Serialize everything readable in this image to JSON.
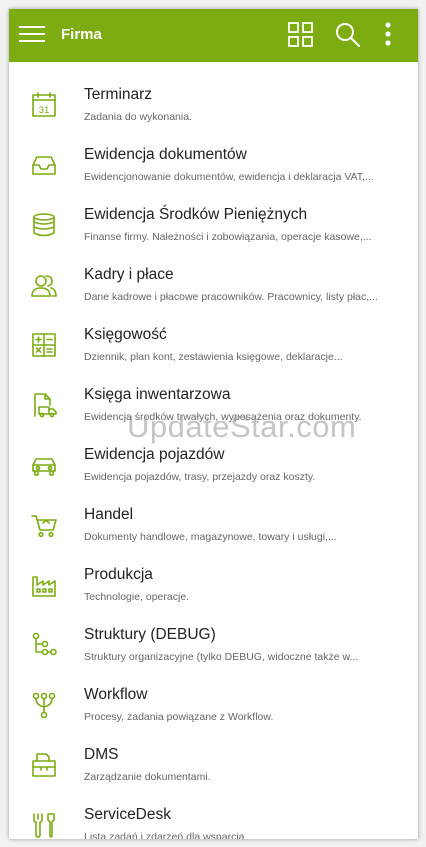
{
  "app": {
    "title": "Firma"
  },
  "toolbar": {
    "menu_icon": "hamburger-menu-icon",
    "grid_icon": "grid-view-icon",
    "search_icon": "search-icon",
    "more_icon": "more-vertical-icon"
  },
  "colors": {
    "accent": "#7cab12",
    "background": "#ffffff"
  },
  "modules": [
    {
      "name": "Terminarz",
      "desc": "Zadania do wykonania.",
      "icon": "calendar-icon"
    },
    {
      "name": "Ewidencja dokumentów",
      "desc": "Ewidencjonowanie dokumentów, ewidencja i deklaracja VAT,...",
      "icon": "inbox-tray-icon"
    },
    {
      "name": "Ewidencja Środków Pieniężnych",
      "desc": "Finanse firmy. Należności i zobowiązania, operacje kasowe,...",
      "icon": "coin-stack-icon"
    },
    {
      "name": "Kadry i płace",
      "desc": "Dane kadrowe i płacowe pracowników. Pracownicy, listy płac,...",
      "icon": "people-icon"
    },
    {
      "name": "Księgowość",
      "desc": "Dziennik, plan kont, zestawienia księgowe, deklaracje...",
      "icon": "calculator-icon"
    },
    {
      "name": "Księga inwentarzowa",
      "desc": "Ewidencja środków trwałych, wyposażenia oraz dokumenty.",
      "icon": "document-truck-icon"
    },
    {
      "name": "Ewidencja pojazdów",
      "desc": "Ewidencja pojazdów, trasy, przejazdy oraz koszty.",
      "icon": "car-icon"
    },
    {
      "name": "Handel",
      "desc": "Dokumenty handlowe, magazynowe, towary i usługi,...",
      "icon": "shopping-cart-icon"
    },
    {
      "name": "Produkcja",
      "desc": "Technologie, operacje.",
      "icon": "factory-icon"
    },
    {
      "name": "Struktury (DEBUG)",
      "desc": "Struktury organizacyjne (tylko DEBUG, widoczne także w...",
      "icon": "hierarchy-icon"
    },
    {
      "name": "Workflow",
      "desc": "Procesy, zadania powiązane z Workflow.",
      "icon": "workflow-branch-icon"
    },
    {
      "name": "DMS",
      "desc": "Zarządzanie dokumentami.",
      "icon": "folder-documents-icon"
    },
    {
      "name": "ServiceDesk",
      "desc": "Lista zadań i zdarzeń dla wsparcia",
      "icon": "tools-icon"
    }
  ],
  "watermark": "UpdateStar.com"
}
